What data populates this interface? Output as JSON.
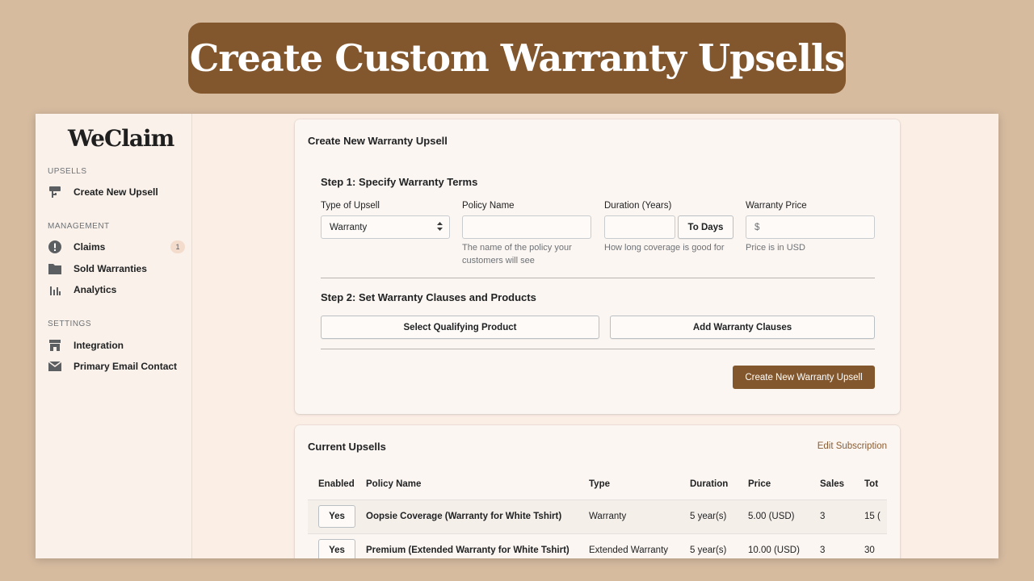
{
  "banner": {
    "title": "Create Custom Warranty Upsells"
  },
  "sidebar": {
    "logo": "WeClaim",
    "sections": [
      {
        "title": "UPSELLS"
      },
      {
        "title": "MANAGEMENT"
      },
      {
        "title": "SETTINGS"
      }
    ],
    "items": [
      {
        "label": "Create New Upsell",
        "icon": "upsell-icon"
      },
      {
        "label": "Claims",
        "icon": "alert-icon",
        "badge": "1"
      },
      {
        "label": "Sold Warranties",
        "icon": "folder-icon"
      },
      {
        "label": "Analytics",
        "icon": "bar-chart-icon"
      },
      {
        "label": "Integration",
        "icon": "store-icon"
      },
      {
        "label": "Primary Email Contact",
        "icon": "mail-icon"
      }
    ]
  },
  "create_card": {
    "title": "Create New Warranty Upsell",
    "step1": {
      "title": "Step 1: Specify Warranty Terms",
      "type_label": "Type of Upsell",
      "type_value": "Warranty",
      "policy_label": "Policy Name",
      "policy_value": "",
      "policy_help": "The name of the policy your customers will see",
      "duration_label": "Duration (Years)",
      "duration_value": "",
      "to_days_label": "To Days",
      "duration_help": "How long coverage is good for",
      "price_label": "Warranty Price",
      "price_prefix": "$",
      "price_value": "",
      "price_help": "Price is in USD"
    },
    "step2": {
      "title": "Step 2: Set Warranty Clauses and Products",
      "select_product_label": "Select Qualifying Product",
      "add_clauses_label": "Add Warranty Clauses"
    },
    "submit_label": "Create New Warranty Upsell"
  },
  "upsells_card": {
    "title": "Current Upsells",
    "edit_link": "Edit Subscription",
    "columns": [
      "Enabled",
      "Policy Name",
      "Type",
      "Duration",
      "Price",
      "Sales",
      "Tot"
    ],
    "rows": [
      {
        "enabled": "Yes",
        "policy": "Oopsie Coverage (Warranty for White Tshirt)",
        "type": "Warranty",
        "duration": "5 year(s)",
        "price": "5.00 (USD)",
        "sales": "3",
        "total": "15 ("
      },
      {
        "enabled": "Yes",
        "policy": "Premium (Extended Warranty for White Tshirt)",
        "type": "Extended Warranty",
        "duration": "5 year(s)",
        "price": "10.00 (USD)",
        "sales": "3",
        "total": "30"
      }
    ]
  },
  "colors": {
    "brand": "#83572d",
    "background": "#d6bb9f",
    "window": "#fbeee5"
  }
}
